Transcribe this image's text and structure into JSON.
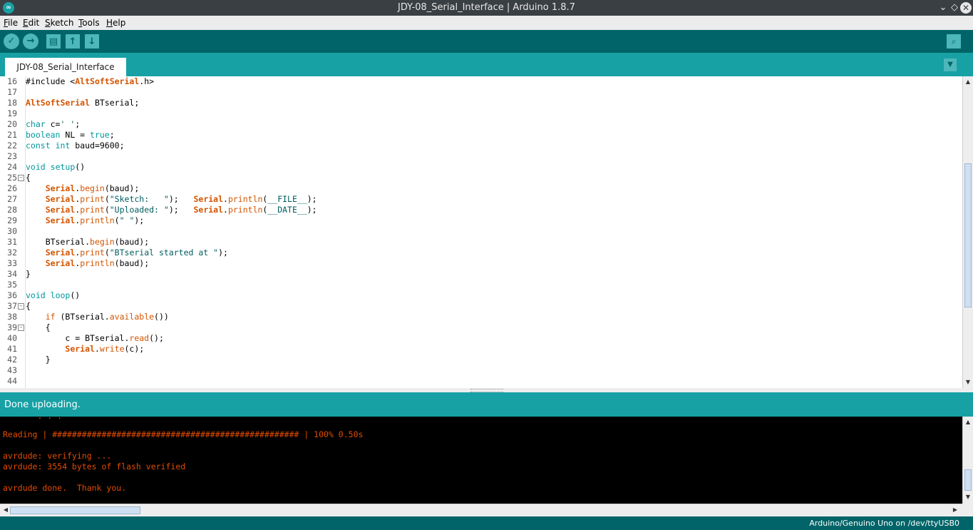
{
  "window": {
    "title": "JDY-08_Serial_Interface | Arduino 1.8.7",
    "icon": "arduino-logo-icon",
    "controls": {
      "minimize": "⌄",
      "maximize": "◇",
      "close": "✕"
    }
  },
  "menu": {
    "file": {
      "key": "F",
      "rest": "ile"
    },
    "edit": {
      "key": "E",
      "rest": "dit"
    },
    "sketch": {
      "key": "S",
      "rest": "ketch"
    },
    "tools": {
      "key": "T",
      "rest": "ools"
    },
    "help": {
      "key": "H",
      "rest": "elp"
    }
  },
  "toolbar": {
    "verify_icon": "✓",
    "upload_icon": "→",
    "new_icon": "▤",
    "open_icon": "↑",
    "save_icon": "↓",
    "serial_monitor_icon": "⌕"
  },
  "tabs": {
    "active": "JDY-08_Serial_Interface",
    "menu_icon": "▼"
  },
  "editor": {
    "line_numbers": [
      "16",
      "17",
      "18",
      "19",
      "20",
      "21",
      "22",
      "23",
      "24",
      "25",
      "26",
      "27",
      "28",
      "29",
      "30",
      "31",
      "32",
      "33",
      "34",
      "35",
      "36",
      "37",
      "38",
      "39",
      "40",
      "41",
      "42",
      "43",
      "44"
    ],
    "fold_marker": "−",
    "code": {
      "l16_a": "#include <",
      "l16_b": "AltSoftSerial",
      "l16_c": ".h>",
      "l18_a": "AltSoftSerial",
      "l18_b": " BTserial;",
      "l20_a": "char",
      "l20_b": " c=",
      "l20_c": "' '",
      "l20_d": ";",
      "l21_a": "boolean",
      "l21_b": " NL = ",
      "l21_c": "true",
      "l21_d": ";",
      "l22_a": "const",
      "l22_b": " ",
      "l22_c": "int",
      "l22_d": " baud=9600;",
      "l24_a": "void",
      "l24_b": " ",
      "l24_c": "setup",
      "l24_d": "()",
      "l25": "{",
      "l26_a": "    ",
      "l26_b": "Serial",
      "l26_c": ".",
      "l26_d": "begin",
      "l26_e": "(baud);",
      "l27_a": "    ",
      "l27_b": "Serial",
      "l27_c": ".",
      "l27_d": "print",
      "l27_e": "(",
      "l27_f": "\"Sketch:   \"",
      "l27_g": ");   ",
      "l27_h": "Serial",
      "l27_i": ".",
      "l27_j": "println",
      "l27_k": "(",
      "l27_l": "__FILE__",
      "l27_m": ");",
      "l28_a": "    ",
      "l28_b": "Serial",
      "l28_c": ".",
      "l28_d": "print",
      "l28_e": "(",
      "l28_f": "\"Uploaded: \"",
      "l28_g": ");   ",
      "l28_h": "Serial",
      "l28_i": ".",
      "l28_j": "println",
      "l28_k": "(",
      "l28_l": "__DATE__",
      "l28_m": ");",
      "l29_a": "    ",
      "l29_b": "Serial",
      "l29_c": ".",
      "l29_d": "println",
      "l29_e": "(",
      "l29_f": "\" \"",
      "l29_g": ");",
      "l31": "    BTserial.",
      "l31_b": "begin",
      "l31_c": "(baud);",
      "l32_a": "    ",
      "l32_b": "Serial",
      "l32_c": ".",
      "l32_d": "print",
      "l32_e": "(",
      "l32_f": "\"BTserial started at \"",
      "l32_g": ");",
      "l33_a": "    ",
      "l33_b": "Serial",
      "l33_c": ".",
      "l33_d": "println",
      "l33_e": "(baud);",
      "l34": "}",
      "l36_a": "void",
      "l36_b": " ",
      "l36_c": "loop",
      "l36_d": "()",
      "l37": "{",
      "l38_a": "    ",
      "l38_b": "if",
      "l38_c": " (BTserial.",
      "l38_d": "available",
      "l38_e": "())",
      "l39": "    {",
      "l40_a": "        c = BTserial.",
      "l40_b": "read",
      "l40_c": "();",
      "l41_a": "        ",
      "l41_b": "Serial",
      "l41_c": ".",
      "l41_d": "write",
      "l41_e": "(c);",
      "l42": "    }"
    }
  },
  "scrollbar": {
    "up": "▲",
    "down": "▼",
    "left": "◀",
    "right": "▶",
    "grip": "≡",
    "hgrip": "|||"
  },
  "status": {
    "text": "Done uploading."
  },
  "console": {
    "lines": [
      "Reading | ################################################## | 100% 0.50s",
      "",
      "avrdude: verifying ...",
      "avrdude: 3554 bytes of flash verified",
      "",
      "avrdude done.  Thank you."
    ]
  },
  "bottom": {
    "board": "Arduino/Genuino Uno on /dev/ttyUSB0"
  },
  "colors": {
    "teal_dark": "#006468",
    "teal": "#17a1a5",
    "keyword": "#00979c",
    "function": "#d35400",
    "console_text": "#e34c00"
  }
}
